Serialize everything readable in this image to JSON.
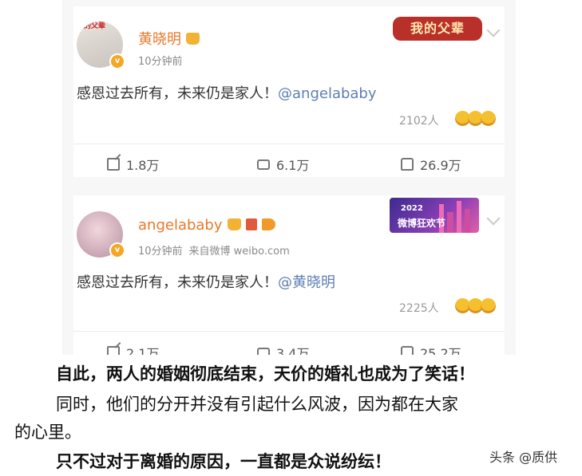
{
  "post1": {
    "banner_text": "我的父辈",
    "avatar_caption": "我的父辈",
    "username": "黄晓明",
    "time": "10分钟前",
    "text_main": "感恩过去所有，未来仍是家人！",
    "mention": "@angelababy",
    "likes_count": "2102人",
    "actions": {
      "share": "1.8万",
      "comment": "6.1万",
      "like": "26.9万"
    }
  },
  "post2": {
    "banner_year": "2022",
    "banner_text": "微博狂欢节",
    "username": "angelababy",
    "time": "10分钟前",
    "source": "来自微博 weibo.com",
    "text_main": "感恩过去所有，未来仍是家人！",
    "mention": "@黄晓明",
    "likes_count": "2225人",
    "actions": {
      "share": "2.1万",
      "comment": "3.4万",
      "like": "25.2万"
    }
  },
  "article": {
    "line1": "自此，两人的婚姻彻底结束，天价的婚礼也成为了笑话！",
    "line2": "同时，他们的分开并没有引起什么风波，因为都在大家",
    "line3": "的心里。",
    "line4": "只不过对于离婚的原因，一直都是众说纷纭！"
  },
  "watermark": "头条 @质供"
}
